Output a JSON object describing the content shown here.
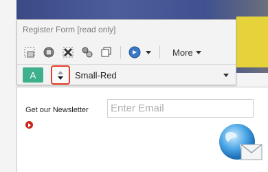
{
  "toolbar": {
    "title": "Register Form [read only]",
    "icons": [
      "template-icon",
      "copy-icon",
      "cut-icon",
      "paste-icon",
      "duplicate-icon",
      "navigate-icon"
    ],
    "more_label": "More",
    "a_button_label": "A",
    "style_select_value": "Small-Red"
  },
  "panel": {
    "newsletter_label": "Get our Newsletter",
    "email_placeholder": "Enter Email"
  },
  "colors": {
    "accent_green": "#3fb08d",
    "highlight_red": "#e53b28",
    "go_red": "#c7251d"
  }
}
